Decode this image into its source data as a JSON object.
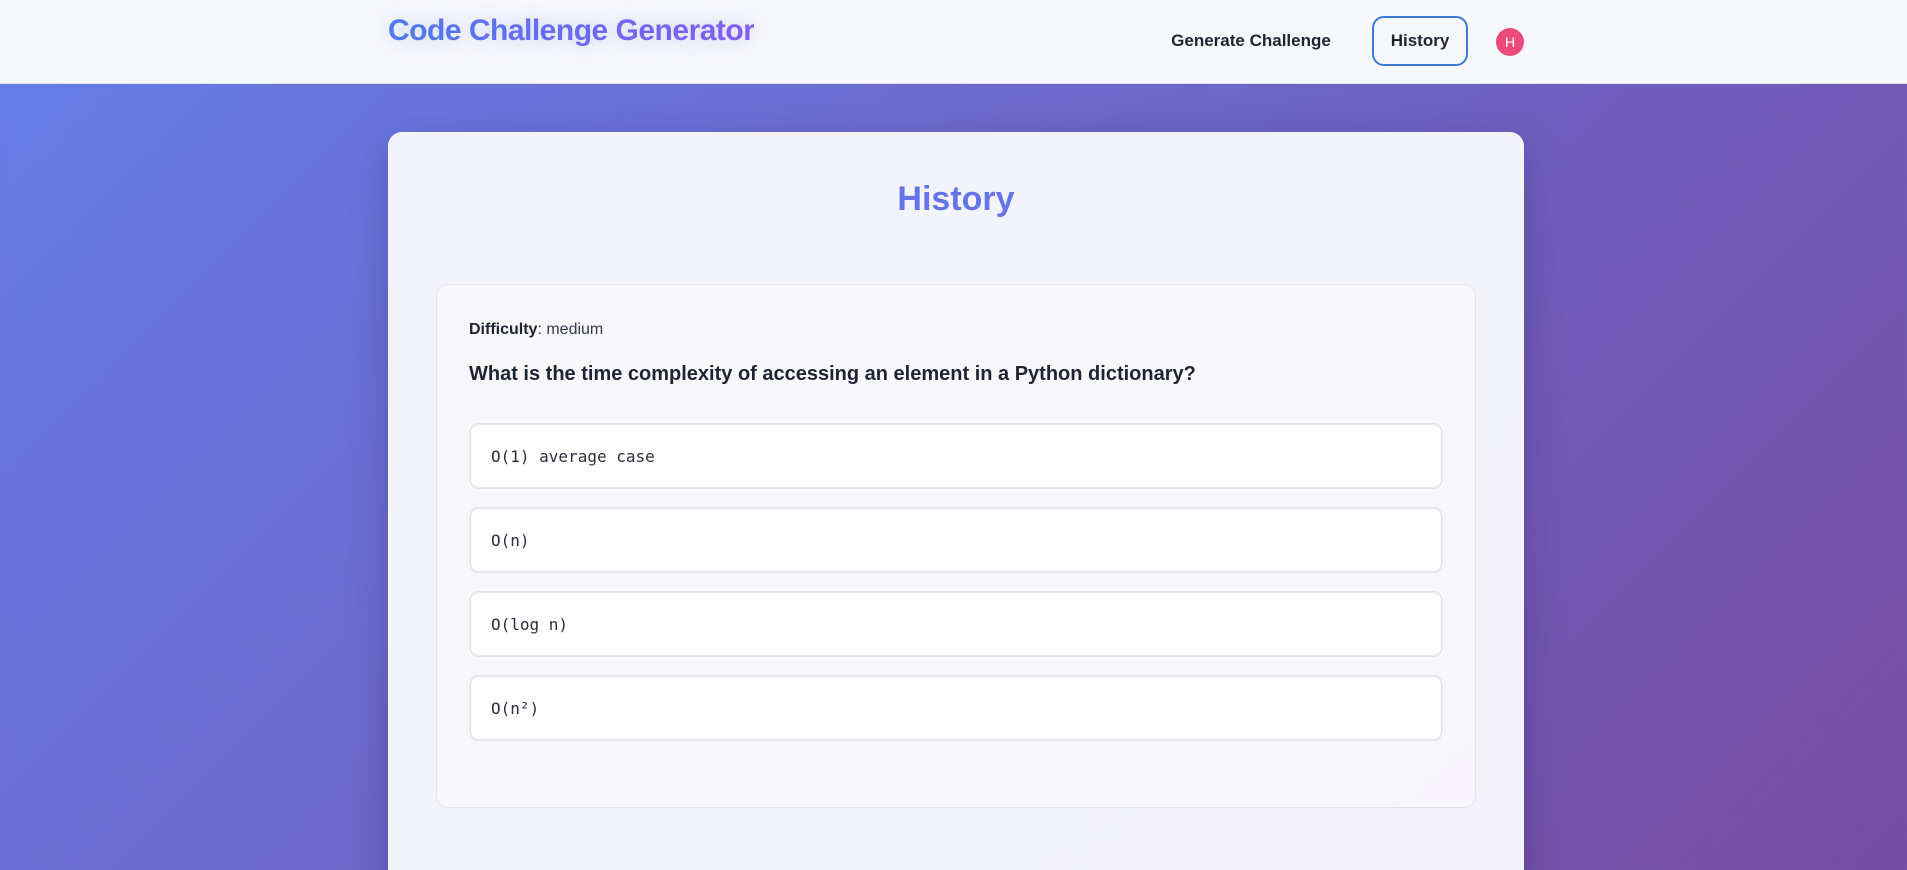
{
  "header": {
    "brand": "Code Challenge Generator",
    "nav": {
      "generate_label": "Generate Challenge",
      "history_label": "History"
    },
    "avatar_initial": "H"
  },
  "main": {
    "title": "History",
    "challenge": {
      "difficulty_label": "Difficulty",
      "difficulty_value": "medium",
      "question": "What is the time complexity of accessing an element in a Python dictionary?",
      "options": [
        "O(1) average case",
        "O(n)",
        "O(log n)",
        "O(n²)"
      ]
    }
  },
  "colors": {
    "gradient_start": "#667eea",
    "gradient_end": "#764ba2",
    "title_accent": "#6674ea",
    "active_nav_border": "#3a7bd5",
    "avatar_bg": "#ec4a7c"
  }
}
